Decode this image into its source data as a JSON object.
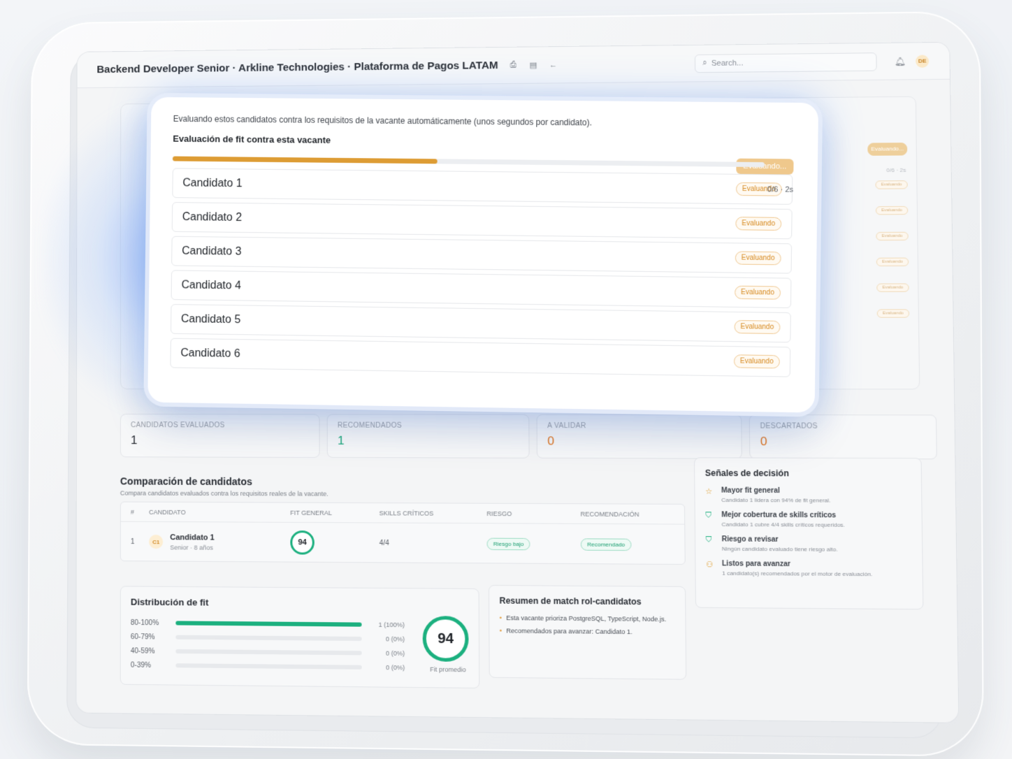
{
  "header": {
    "title": "Backend Developer Senior · Arkline Technologies · Plataforma de Pagos LATAM",
    "search_placeholder": "Search...",
    "avatar_initials": "DE"
  },
  "modal": {
    "description": "Evaluando estos candidatos contra los requisitos de la vacante automáticamente (unos segundos por candidato).",
    "title": "Evaluación de fit contra esta vacante",
    "status": "Evaluando...",
    "progress": 0.45,
    "progress_count": "0/6 · 2s",
    "candidates": [
      {
        "name": "Candidato 1",
        "status": "Evaluando"
      },
      {
        "name": "Candidato 2",
        "status": "Evaluando"
      },
      {
        "name": "Candidato 3",
        "status": "Evaluando"
      },
      {
        "name": "Candidato 4",
        "status": "Evaluando"
      },
      {
        "name": "Candidato 5",
        "status": "Evaluando"
      },
      {
        "name": "Candidato 6",
        "status": "Evaluando"
      }
    ]
  },
  "background_card": {
    "status": "Evaluando...",
    "count": "0/6 · 2s",
    "row_status": "Evaluando"
  },
  "stats": [
    {
      "label": "CANDIDATOS EVALUADOS",
      "value": "1"
    },
    {
      "label": "RECOMENDADOS",
      "value": "1"
    },
    {
      "label": "A VALIDAR",
      "value": "0"
    },
    {
      "label": "DESCARTADOS",
      "value": "0"
    }
  ],
  "comparison": {
    "title": "Comparación de candidatos",
    "subtitle": "Compara candidatos evaluados contra los requisitos reales de la vacante.",
    "columns": [
      "#",
      "CANDIDATO",
      "FIT GENERAL",
      "SKILLS CRÍTICOS",
      "RIESGO",
      "RECOMENDACIÓN"
    ],
    "row": {
      "num": "1",
      "badge": "C1",
      "name": "Candidato 1",
      "meta": "Senior · 8 años",
      "fit": "94",
      "skills": "4/4",
      "risk": "Riesgo bajo",
      "recommendation": "Recomendado"
    }
  },
  "signals": {
    "title": "Señales de decisión",
    "items": [
      {
        "icon": "star-icon",
        "title": "Mayor fit general",
        "text": "Candidato 1 lidera con 94% de fit general."
      },
      {
        "icon": "shield-check-icon",
        "title": "Mejor cobertura de skills críticos",
        "text": "Candidato 1 cubre 4/4 skills críticos requeridos."
      },
      {
        "icon": "shield-check-icon",
        "title": "Riesgo a revisar",
        "text": "Ningún candidato evaluado tiene riesgo alto."
      },
      {
        "icon": "users-icon",
        "title": "Listos para avanzar",
        "text": "1 candidato(s) recomendados por el motor de evaluación."
      }
    ]
  },
  "distribution": {
    "title": "Distribución de fit",
    "rows": [
      {
        "label": "80-100%",
        "fraction": 1.0,
        "value": "1 (100%)"
      },
      {
        "label": "60-79%",
        "fraction": 0,
        "value": "0 (0%)"
      },
      {
        "label": "40-59%",
        "fraction": 0,
        "value": "0 (0%)"
      },
      {
        "label": "0-39%",
        "fraction": 0,
        "value": "0 (0%)"
      }
    ],
    "average": "94",
    "average_label": "Fit promedio"
  },
  "summary": {
    "title": "Resumen de match rol-candidatos",
    "items": [
      "Esta vacante prioriza PostgreSQL, TypeScript, Node.js.",
      "Recomendados para avanzar: Candidato 1."
    ]
  },
  "colors": {
    "accent_orange": "#dd9c34",
    "accent_green": "#1cb07f",
    "glow_blue": "#5a96ff"
  }
}
